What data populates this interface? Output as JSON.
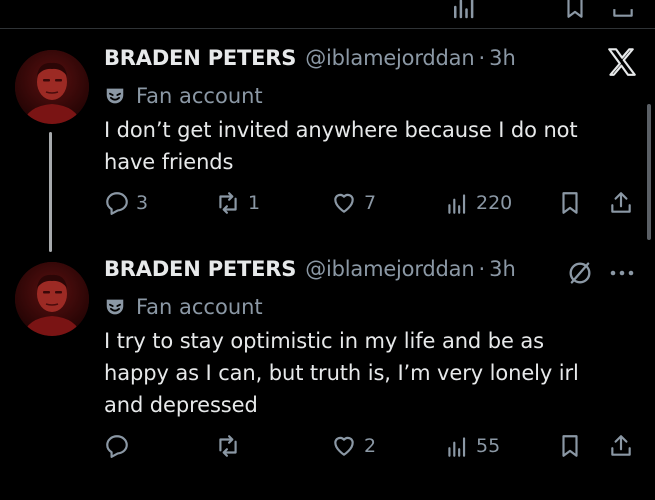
{
  "tweets": [
    {
      "display_name": "BRADEN PETERS",
      "handle": "@iblamejorddan",
      "separator": "·",
      "time": "3h",
      "label": "Fan account",
      "text": "I don’t get invited anywhere because I do not have friends",
      "stats": {
        "replies": "3",
        "reposts": "1",
        "likes": "7",
        "views": "220"
      }
    },
    {
      "display_name": "BRADEN PETERS",
      "handle": "@iblamejorddan",
      "separator": "·",
      "time": "3h",
      "label": "Fan account",
      "text": "I try to stay optimistic in my life and be as happy as I can, but truth is, I’m very lonely irl and depressed",
      "stats": {
        "replies": "",
        "reposts": "",
        "likes": "2",
        "views": "55"
      }
    }
  ],
  "colors": {
    "background": "#000000",
    "text": "#e7e9ea",
    "secondary": "#8b98a5",
    "divider": "#2f3336"
  },
  "icons": [
    "reply-icon",
    "repost-icon",
    "like-icon",
    "views-icon",
    "bookmark-icon",
    "share-icon",
    "fan-mask-icon",
    "x-logo-icon",
    "grok-icon",
    "more-icon"
  ]
}
